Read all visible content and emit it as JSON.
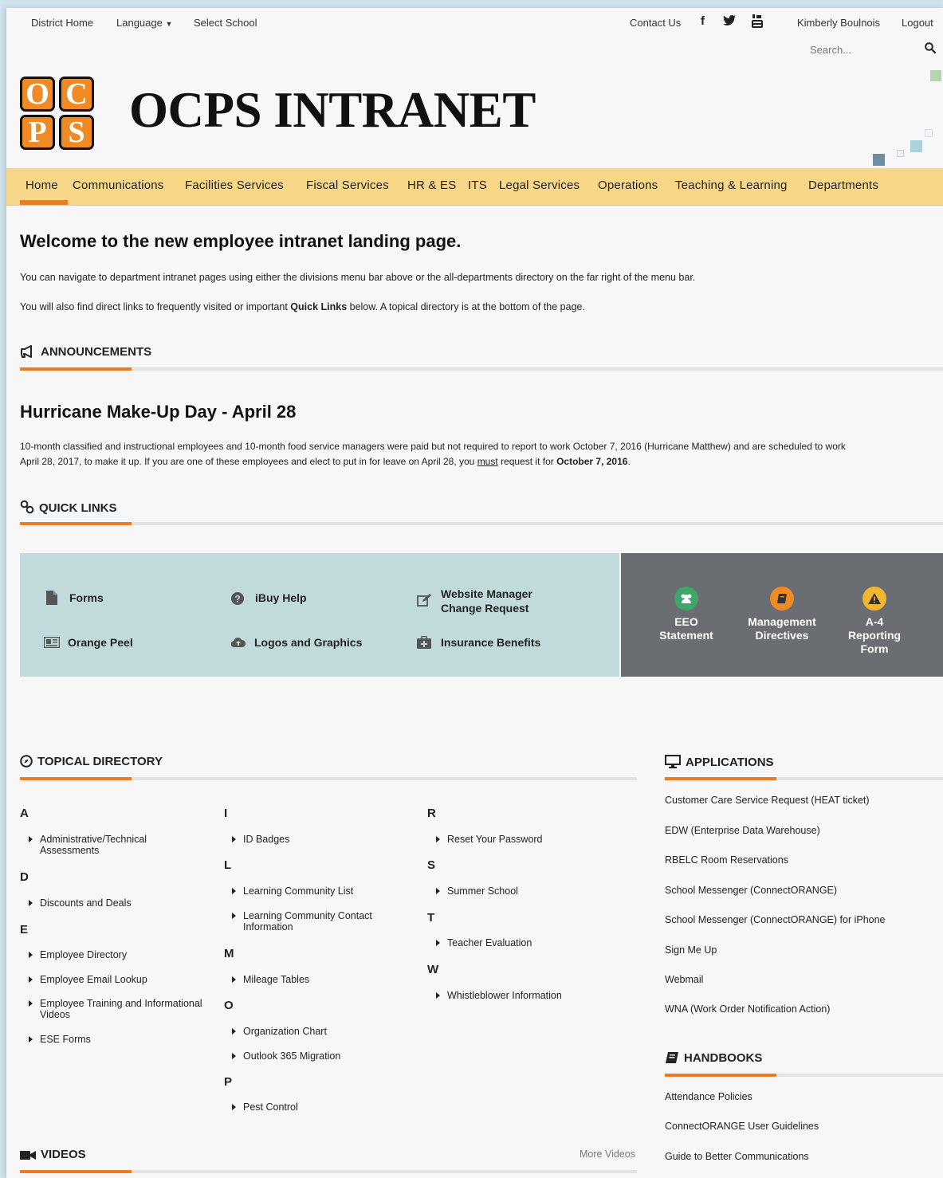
{
  "utility": {
    "district_home": "District Home",
    "language": "Language",
    "select_school": "Select School",
    "contact_us": "Contact Us",
    "user_name": "Kimberly Boulnois",
    "logout": "Logout",
    "search_placeholder": "Search..."
  },
  "logo": {
    "letters": [
      "O",
      "C",
      "P",
      "S"
    ]
  },
  "site_title": "OCPS INTRANET",
  "nav": {
    "items": [
      "Home",
      "Communications",
      "Facilities Services",
      "Fiscal Services",
      "HR & ES",
      "ITS",
      "Legal Services",
      "Operations",
      "Teaching & Learning",
      "Departments"
    ],
    "active": "Home"
  },
  "welcome": {
    "heading": "Welcome to the new employee intranet landing page.",
    "p1": "You can navigate to department intranet pages using either the divisions menu bar above or the all-departments directory on the far right of the menu bar.",
    "p2_before": "You will also find direct links to frequently visited or important ",
    "p2_bold": "Quick Links",
    "p2_after": " below. A topical directory is at the bottom of the page."
  },
  "announcements": {
    "header": "ANNOUNCEMENTS",
    "title": "Hurricane Make-Up Day - April 28",
    "line1": "10-month classified and instructional employees and 10-month food service managers were paid but not required to report to work October 7, 2016 (Hurricane Matthew) and are scheduled to work",
    "line2_a": "April 28, 2017, to make it up. If you are one of these employees and elect to put in for leave on April 28, you ",
    "line2_u": "must",
    "line2_b": " request it for ",
    "line2_bold": "October 7, 2016",
    "line2_end": "."
  },
  "quick_links": {
    "header": "QUICK LINKS",
    "items": [
      {
        "label": "Forms",
        "icon": "file-icon"
      },
      {
        "label": "iBuy Help",
        "icon": "question-icon"
      },
      {
        "label": "Website Manager Change Request",
        "line1": "Website Manager",
        "line2": "Change Request",
        "icon": "edit-icon"
      },
      {
        "label": "Orange Peel",
        "icon": "newspaper-icon"
      },
      {
        "label": "Logos and Graphics",
        "icon": "cloud-upload-icon"
      },
      {
        "label": "Insurance Benefits",
        "icon": "medkit-icon"
      }
    ],
    "apps": [
      {
        "line1": "EEO",
        "line2": "Statement",
        "color": "#3fa66a",
        "icon": "users-icon"
      },
      {
        "line1": "Management",
        "line2": "Directives",
        "color": "#f08a24",
        "icon": "book-icon"
      },
      {
        "line1": "A-4",
        "line2": "Reporting",
        "line3": "Form",
        "color": "#f2b630",
        "icon": "warning-icon"
      }
    ]
  },
  "topical_directory": {
    "header": "TOPICAL DIRECTORY",
    "col1": {
      "A": "A",
      "A1a": "Administrative/Technical",
      "A1b": "Assessments",
      "D": "D",
      "D1": "Discounts and Deals",
      "E": "E",
      "E1": "Employee Directory",
      "E2": "Employee Email Lookup",
      "E3a": "Employee Training and Informational",
      "E3b": "Videos",
      "E4": "ESE Forms"
    },
    "col2": {
      "I": "I",
      "I1": "ID Badges",
      "L": "L",
      "L1": "Learning Community List",
      "L2a": "Learning Community Contact",
      "L2b": "Information",
      "M": "M",
      "M1": "Mileage Tables",
      "O": "O",
      "O1": "Organization Chart",
      "O2": "Outlook 365 Migration",
      "P": "P",
      "P1": "Pest Control"
    },
    "col3": {
      "R": "R",
      "R1": "Reset Your Password",
      "S": "S",
      "S1": "Summer School",
      "T": "T",
      "T1": "Teacher Evaluation",
      "W": "W",
      "W1": "Whistleblower Information"
    }
  },
  "applications": {
    "header": "APPLICATIONS",
    "items": [
      "Customer Care Service Request (HEAT ticket)",
      "EDW (Enterprise Data Warehouse)",
      "RBELC Room Reservations",
      "School Messenger (ConnectORANGE)",
      "School Messenger (ConnectORANGE) for iPhone",
      "Sign Me Up",
      "Webmail",
      "WNA (Work Order Notification Action)"
    ]
  },
  "handbooks": {
    "header": "HANDBOOKS",
    "items": [
      "Attendance Policies",
      "ConnectORANGE User Guidelines",
      "Guide to Better Communications"
    ]
  },
  "videos": {
    "header": "VIDEOS",
    "more": "More Videos"
  },
  "colors": {
    "accent": "#ee7b22",
    "nav_bg": "#f8d888",
    "quick_links_bg": "#c1dadb",
    "apps_bg": "#6a6d72"
  }
}
